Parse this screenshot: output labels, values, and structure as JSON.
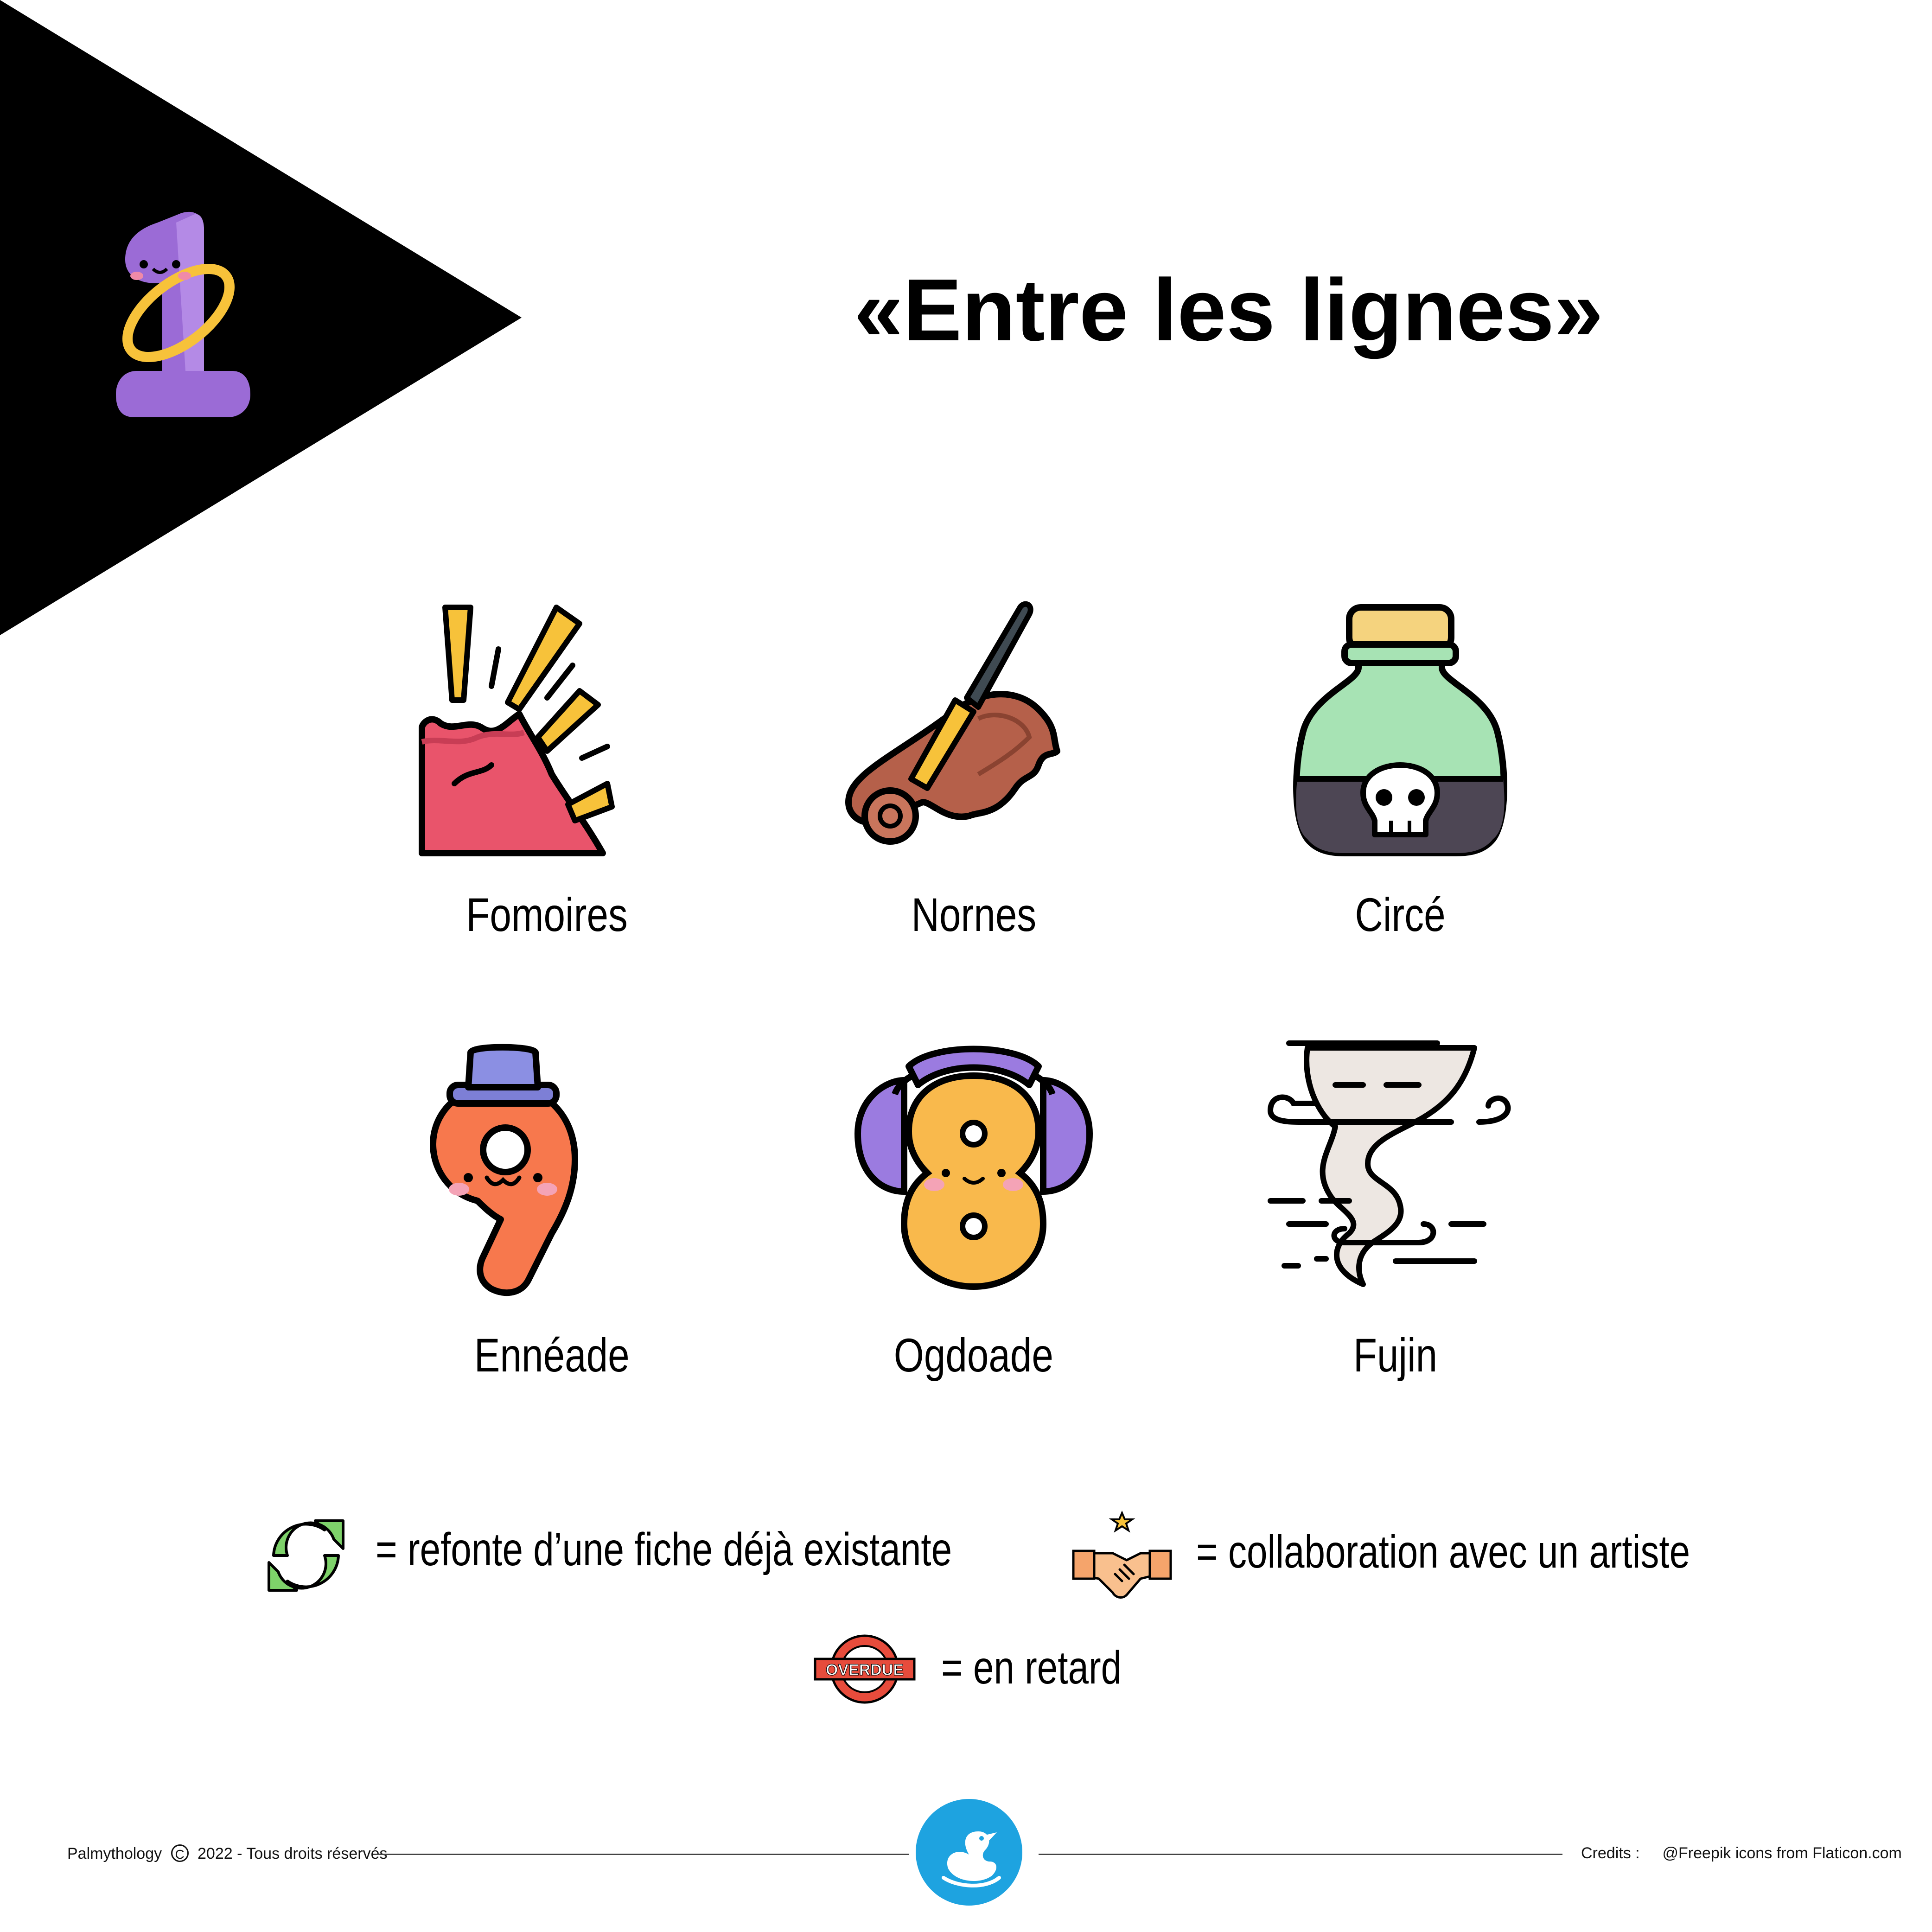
{
  "title": "«Entre les lignes»",
  "badge": {
    "icon": "number-one-mascot-icon"
  },
  "items": [
    {
      "label": "Fomoires",
      "icon": "explosion-icon"
    },
    {
      "label": "Nornes",
      "icon": "quill-scroll-icon"
    },
    {
      "label": "Circé",
      "icon": "poison-bottle-icon"
    },
    {
      "label": "Ennéade",
      "icon": "number-nine-mascot-icon"
    },
    {
      "label": "Ogdoade",
      "icon": "number-eight-mascot-icon"
    },
    {
      "label": "Fujin",
      "icon": "tornado-icon"
    }
  ],
  "legend": {
    "refresh": "= refonte d’une fiche déjà existante",
    "collab": "= collaboration avec un artiste",
    "overdue": "= en retard",
    "overdue_stamp": "OVERDUE"
  },
  "footer": {
    "left": "Palmythology",
    "copyright_symbol": "C",
    "left_rest": "2022 - Tous droits réservés",
    "credits_label": "Credits :",
    "credits_text": "@Freepik icons from Flaticon.com"
  },
  "colors": {
    "black": "#000000",
    "purple": "#9b6bd6",
    "red": "#e9546b",
    "yellow": "#f7c23a",
    "brown": "#b5604a",
    "green": "#a7e3b4",
    "orange": "#f7784d",
    "amber": "#f9b94c",
    "lavender": "#8f7ee0",
    "blue": "#1ea3e0"
  }
}
